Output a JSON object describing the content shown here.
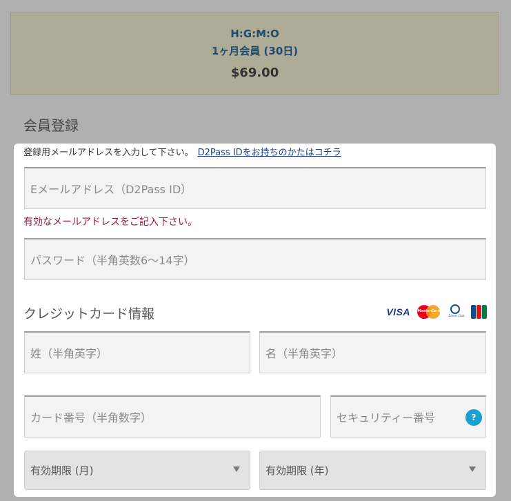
{
  "product": {
    "name": "H:G:M:O",
    "plan": "1ヶ月会員 (30日)",
    "price": "$69.00"
  },
  "registration": {
    "title": "会員登録",
    "notice_text": "登録用メールアドレスを入力して下さい。",
    "notice_link": "D2Pass IDをお持ちのかたはコチラ",
    "email_placeholder": "Eメールアドレス（D2Pass ID）",
    "email_error": "有効なメールアドレスをご記入下さい。",
    "password_placeholder": "パスワード（半角英数6～14字）"
  },
  "credit_card": {
    "title": "クレジットカード情報",
    "brands": {
      "visa": "VISA",
      "mastercard": "MasterCard",
      "diners": "Diners Club",
      "jcb": "JCB"
    },
    "last_name_placeholder": "姓（半角英字）",
    "first_name_placeholder": "名（半角英字）",
    "card_number_placeholder": "カード番号（半角数字）",
    "security_code_placeholder": "セキュリティー番号",
    "help_label": "?",
    "expiry_month_label": "有効期限 (月)",
    "expiry_year_label": "有効期限 (年)"
  },
  "colors": {
    "product_background": "#aeab97",
    "product_text": "#1f4a70",
    "error_text": "#9b1b3c",
    "help_button": "#1aa0d0",
    "jcb_blue": "#0e4c96",
    "jcb_red": "#d7141a",
    "jcb_green": "#007b40"
  }
}
